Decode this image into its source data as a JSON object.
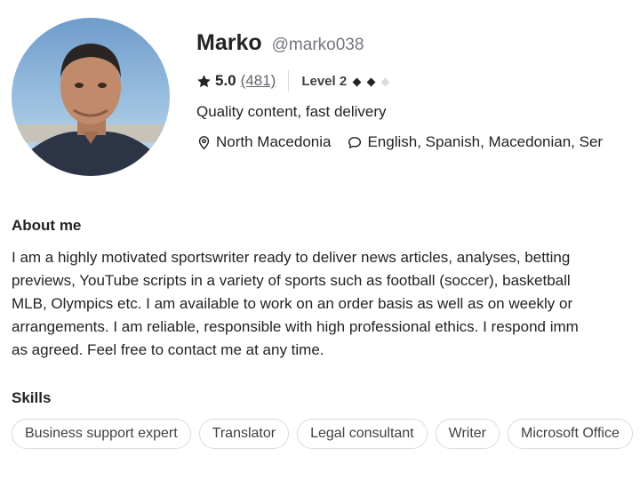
{
  "profile": {
    "name": "Marko",
    "username": "@marko038",
    "rating": "5.0",
    "review_count": "(481)",
    "level": "Level 2",
    "level_value": 2,
    "level_max": 3,
    "tagline": "Quality content, fast delivery",
    "location": "North Macedonia",
    "languages": "English, Spanish, Macedonian, Ser"
  },
  "about": {
    "title": "About me",
    "lines": [
      "I am a highly motivated sportswriter ready to deliver news articles, analyses, betting",
      "previews, YouTube scripts in a variety of sports such as football (soccer), basketball",
      "MLB, Olympics etc. I am available to work on an order basis as well as on weekly or",
      "arrangements. I am reliable, responsible with high professional ethics. I respond imm",
      "as agreed. Feel free to contact me at any time."
    ]
  },
  "skills": {
    "title": "Skills",
    "items": [
      "Business support expert",
      "Translator",
      "Legal consultant",
      "Writer",
      "Microsoft Office"
    ]
  },
  "icons": {
    "star": "star-icon",
    "location": "location-pin-icon",
    "language": "speech-bubble-icon"
  },
  "colors": {
    "text": "#222325",
    "muted": "#74767e",
    "border": "#dadbdd",
    "level_diamond": "#222325"
  }
}
